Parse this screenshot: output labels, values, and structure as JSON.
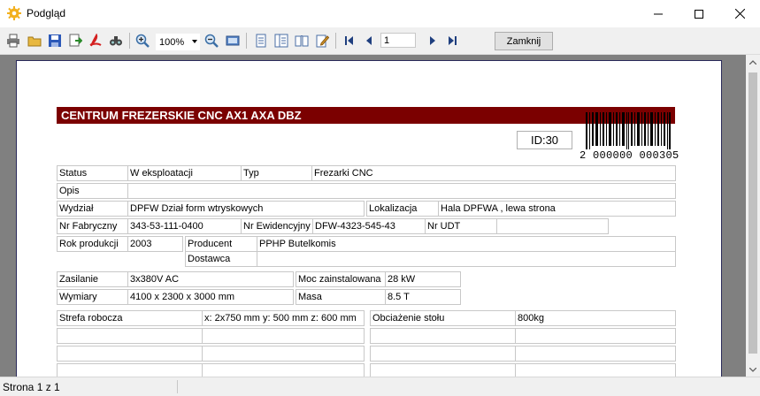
{
  "window": {
    "title": "Podgląd"
  },
  "toolbar": {
    "zoom_value": "100%",
    "page_value": "1",
    "close_label": "Zamknij"
  },
  "report": {
    "header_title": "CENTRUM FREZERSKIE CNC  AX1  AXA DBZ",
    "id_label": "ID:30",
    "barcode_number": "2 000000 000305",
    "status_label": "Status",
    "status_value": "W eksploatacji",
    "typ_label": "Typ",
    "typ_value": "Frezarki CNC",
    "opis_label": "Opis",
    "opis_value": "",
    "wydzial_label": "Wydział",
    "wydzial_value": "DPFW Dział form wtryskowych",
    "lokalizacja_label": "Lokalizacja",
    "lokalizacja_value": "Hala DPFWA , lewa strona",
    "nr_fabryczny_label": "Nr Fabryczny",
    "nr_fabryczny_value": "343-53-111-0400",
    "nr_ewidencyjny_label": "Nr Ewidencyjny",
    "nr_ewidencyjny_value": "DFW-4323-545-43",
    "nr_udt_label": "Nr UDT",
    "nr_udt_value": "",
    "rok_label": "Rok produkcji",
    "rok_value": "2003",
    "producent_label": "Producent",
    "producent_value": "PPHP Butelkomis",
    "dostawca_label": "Dostawca",
    "dostawca_value": "",
    "zasilanie_label": "Zasilanie",
    "zasilanie_value": "3x380V AC",
    "moc_label": "Moc zainstalowana",
    "moc_value": "28 kW",
    "wymiary_label": "Wymiary",
    "wymiary_value": "4100 x 2300 x 3000 mm",
    "masa_label": "Masa",
    "masa_value": "8.5 T",
    "strefa_label": "Strefa robocza",
    "strefa_value": "x: 2x750 mm  y: 500 mm  z: 600 mm",
    "obciazenie_label": "Obciażenie stołu",
    "obciazenie_value": "800kg"
  },
  "statusbar": {
    "text": "Strona 1 z 1"
  },
  "icons": [
    "app-gear-icon",
    "minimize-icon",
    "maximize-icon",
    "close-icon",
    "print-icon",
    "open-icon",
    "save-icon",
    "export-icon",
    "pdf-icon",
    "find-icon",
    "zoom-in-icon",
    "zoom-out-icon",
    "fit-page-icon",
    "single-page-icon",
    "multi-page-icon",
    "book-icon",
    "edit-icon",
    "first-page-icon",
    "prev-page-icon",
    "next-page-icon",
    "last-page-icon"
  ]
}
